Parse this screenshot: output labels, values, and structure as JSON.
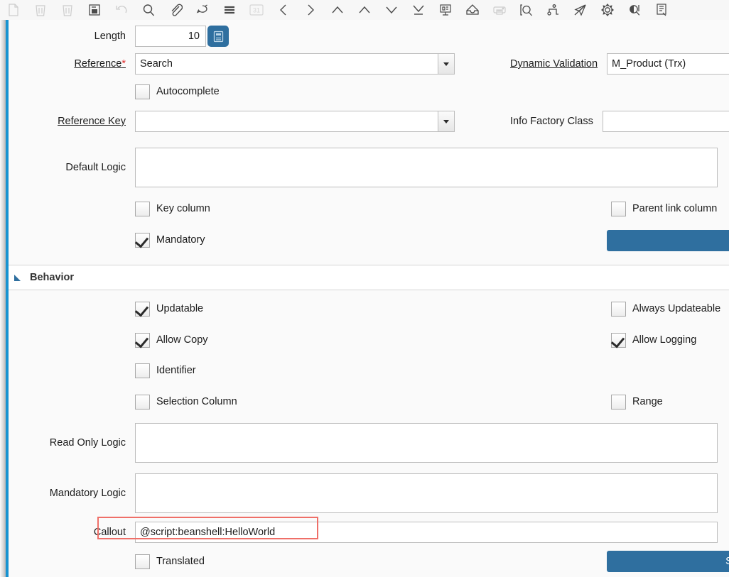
{
  "toolbar": {
    "items": [
      {
        "name": "new-record-icon",
        "label": "New Record",
        "disabled": true
      },
      {
        "name": "delete-record-icon",
        "label": "Delete Record",
        "disabled": true
      },
      {
        "name": "delete-selection-icon",
        "label": "Delete Selection",
        "disabled": true
      },
      {
        "name": "save-icon",
        "label": "Save Changes",
        "disabled": false
      },
      {
        "name": "undo-icon",
        "label": "Undo Changes",
        "disabled": true
      },
      {
        "name": "find-icon",
        "label": "Find Record",
        "disabled": false
      },
      {
        "name": "attachment-icon",
        "label": "Attachment",
        "disabled": false
      },
      {
        "name": "chat-icon",
        "label": "Chat / Notes",
        "disabled": false
      },
      {
        "name": "menu-icon",
        "label": "Grid Toggle",
        "disabled": false
      },
      {
        "name": "calendar-icon",
        "label": "Requests",
        "disabled": true
      },
      {
        "name": "previous-record-icon",
        "label": "Previous Record",
        "disabled": false
      },
      {
        "name": "next-record-icon",
        "label": "Next Record",
        "disabled": false
      },
      {
        "name": "first-record-icon",
        "label": "First Record",
        "disabled": false
      },
      {
        "name": "parent-record-icon",
        "label": "Parent Record",
        "disabled": false
      },
      {
        "name": "detail-record-icon",
        "label": "Detail Record",
        "disabled": false
      },
      {
        "name": "last-record-icon",
        "label": "Last Record",
        "disabled": false
      },
      {
        "name": "report-view-icon",
        "label": "Report View",
        "disabled": false
      },
      {
        "name": "archive-icon",
        "label": "Archive",
        "disabled": false
      },
      {
        "name": "print-icon",
        "label": "Print",
        "disabled": true
      },
      {
        "name": "zoom-across-icon",
        "label": "Zoom Across",
        "disabled": false
      },
      {
        "name": "workflow-icon",
        "label": "Workflow",
        "disabled": false
      },
      {
        "name": "send-mail-icon",
        "label": "Send Mail",
        "disabled": false
      },
      {
        "name": "preference-icon",
        "label": "Preference",
        "disabled": false
      },
      {
        "name": "contrast-view-icon",
        "label": "View Mode",
        "disabled": false
      },
      {
        "name": "export-icon",
        "label": "Export",
        "disabled": false
      }
    ]
  },
  "form": {
    "length": {
      "label": "Length",
      "value": "10",
      "calculator_button": "calculator-icon"
    },
    "reference": {
      "label": "Reference",
      "required_marker": "*",
      "value": "Search"
    },
    "dynamic_validation": {
      "label": "Dynamic Validation",
      "value": "M_Product (Trx)"
    },
    "autocomplete": {
      "label": "Autocomplete",
      "checked": false
    },
    "reference_key": {
      "label": "Reference Key",
      "value": ""
    },
    "info_factory_class": {
      "label": "Info Factory Class",
      "value": ""
    },
    "default_logic": {
      "label": "Default Logic",
      "value": ""
    },
    "key_column": {
      "label": "Key column",
      "checked": false
    },
    "parent_link_column": {
      "label": "Parent link column",
      "checked": false
    },
    "mandatory": {
      "label": "Mandatory",
      "checked": true
    },
    "top_action_button": {
      "label": ""
    }
  },
  "behavior": {
    "section_title": "Behavior",
    "updatable": {
      "label": "Updatable",
      "checked": true
    },
    "always_updateable": {
      "label": "Always Updateable",
      "checked": false
    },
    "allow_copy": {
      "label": "Allow Copy",
      "checked": true
    },
    "allow_logging": {
      "label": "Allow Logging",
      "checked": true
    },
    "identifier": {
      "label": "Identifier",
      "checked": false
    },
    "selection_column": {
      "label": "Selection Column",
      "checked": false
    },
    "range": {
      "label": "Range",
      "checked": false
    },
    "read_only_logic": {
      "label": "Read Only Logic",
      "value": ""
    },
    "mandatory_logic": {
      "label": "Mandatory Logic",
      "value": ""
    },
    "callout": {
      "label": "Callout",
      "value": "@script:beanshell:HelloWorld",
      "highlighted": true
    },
    "translated": {
      "label": "Translated",
      "checked": false
    },
    "sync_button": {
      "label": "Sy"
    }
  },
  "colors": {
    "accent_blue": "#1793d1",
    "button_blue": "#2f6f9f",
    "annotation_red": "#ef6f68",
    "required_red": "#e03030",
    "panel_bg": "#fafafa"
  }
}
